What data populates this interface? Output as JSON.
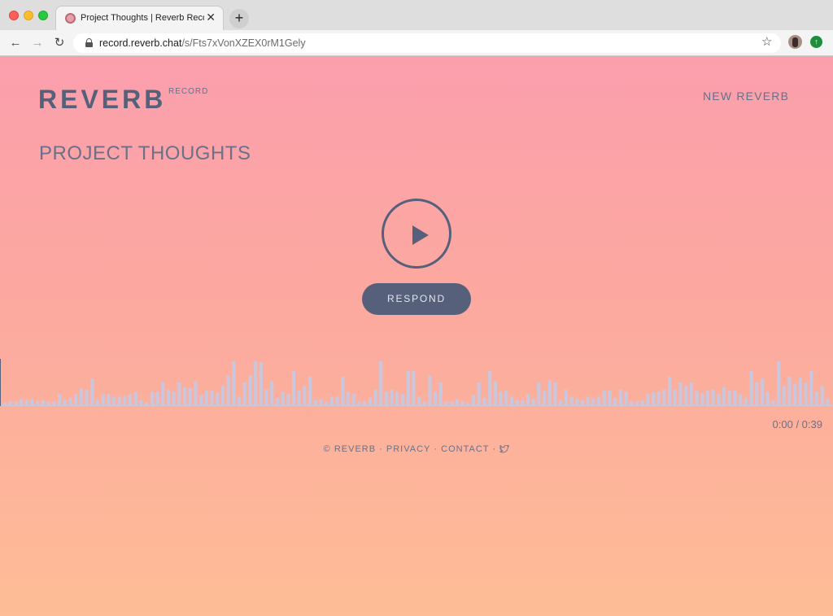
{
  "browser": {
    "tab_title": "Project Thoughts | Reverb Record",
    "tab_close": "✕",
    "new_tab": "+",
    "url_host": "record.reverb.chat",
    "url_path": "/s/Fts7xVonXZEX0rM1Gely"
  },
  "header": {
    "logo": "REVERB",
    "logo_sub": "RECORD",
    "new_reverb_label": "NEW REVERB"
  },
  "recording": {
    "title": "PROJECT THOUGHTS",
    "respond_label": "RESPOND",
    "time_display": "0:00 / 0:39",
    "progress": 0,
    "waveform": [
      3,
      4,
      4,
      6,
      5,
      6,
      4,
      5,
      4,
      4,
      10,
      5,
      7,
      10,
      15,
      14,
      23,
      5,
      10,
      10,
      8,
      8,
      8,
      10,
      12,
      5,
      3,
      12,
      12,
      20,
      14,
      12,
      20,
      16,
      15,
      21,
      9,
      13,
      13,
      11,
      17,
      26,
      38,
      8,
      20,
      26,
      38,
      37,
      14,
      21,
      7,
      12,
      10,
      30,
      13,
      17,
      25,
      5,
      6,
      4,
      8,
      8,
      25,
      12,
      10,
      4,
      4,
      7,
      14,
      38,
      12,
      14,
      12,
      10,
      30,
      30,
      8,
      4,
      26,
      12,
      20,
      4,
      4,
      6,
      4,
      3,
      9,
      20,
      7,
      30,
      21,
      12,
      13,
      8,
      5,
      5,
      10,
      6,
      20,
      13,
      22,
      20,
      5,
      14,
      8,
      6,
      5,
      8,
      6,
      8,
      13,
      13,
      7,
      14,
      12,
      4,
      4,
      5,
      10,
      12,
      12,
      14,
      25,
      14,
      20,
      17,
      20,
      13,
      11,
      13,
      14,
      10,
      16,
      13,
      13,
      10,
      7,
      30,
      20,
      23,
      12,
      5,
      38,
      17,
      25,
      19,
      24,
      20,
      30,
      12,
      17,
      6
    ]
  },
  "footer": {
    "copyright": "© REVERB",
    "privacy": "PRIVACY",
    "contact": "CONTACT",
    "sep": "·"
  },
  "colors": {
    "accent": "#56607a",
    "wave": "#c9c7dd"
  }
}
